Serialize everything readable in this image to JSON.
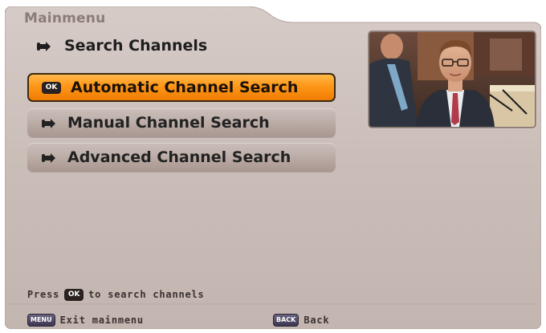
{
  "menu": {
    "title": "Mainmenu",
    "submenu_title": "Search Channels",
    "items": [
      {
        "label": "Automatic Channel Search",
        "icon": "ok-badge",
        "badge": "OK",
        "selected": true
      },
      {
        "label": "Manual Channel Search",
        "icon": "arrow-icon",
        "selected": false
      },
      {
        "label": "Advanced Channel Search",
        "icon": "arrow-icon",
        "selected": false
      }
    ]
  },
  "hint": {
    "prefix": "Press",
    "badge": "OK",
    "suffix": "to search channels"
  },
  "footer": {
    "menu_key": "MENU",
    "menu_label": "Exit mainmenu",
    "back_key": "BACK",
    "back_label": "Back"
  },
  "colors": {
    "panel": "#c8bbb6",
    "selected": "#ff9a1c",
    "item": "#bdaea8"
  }
}
